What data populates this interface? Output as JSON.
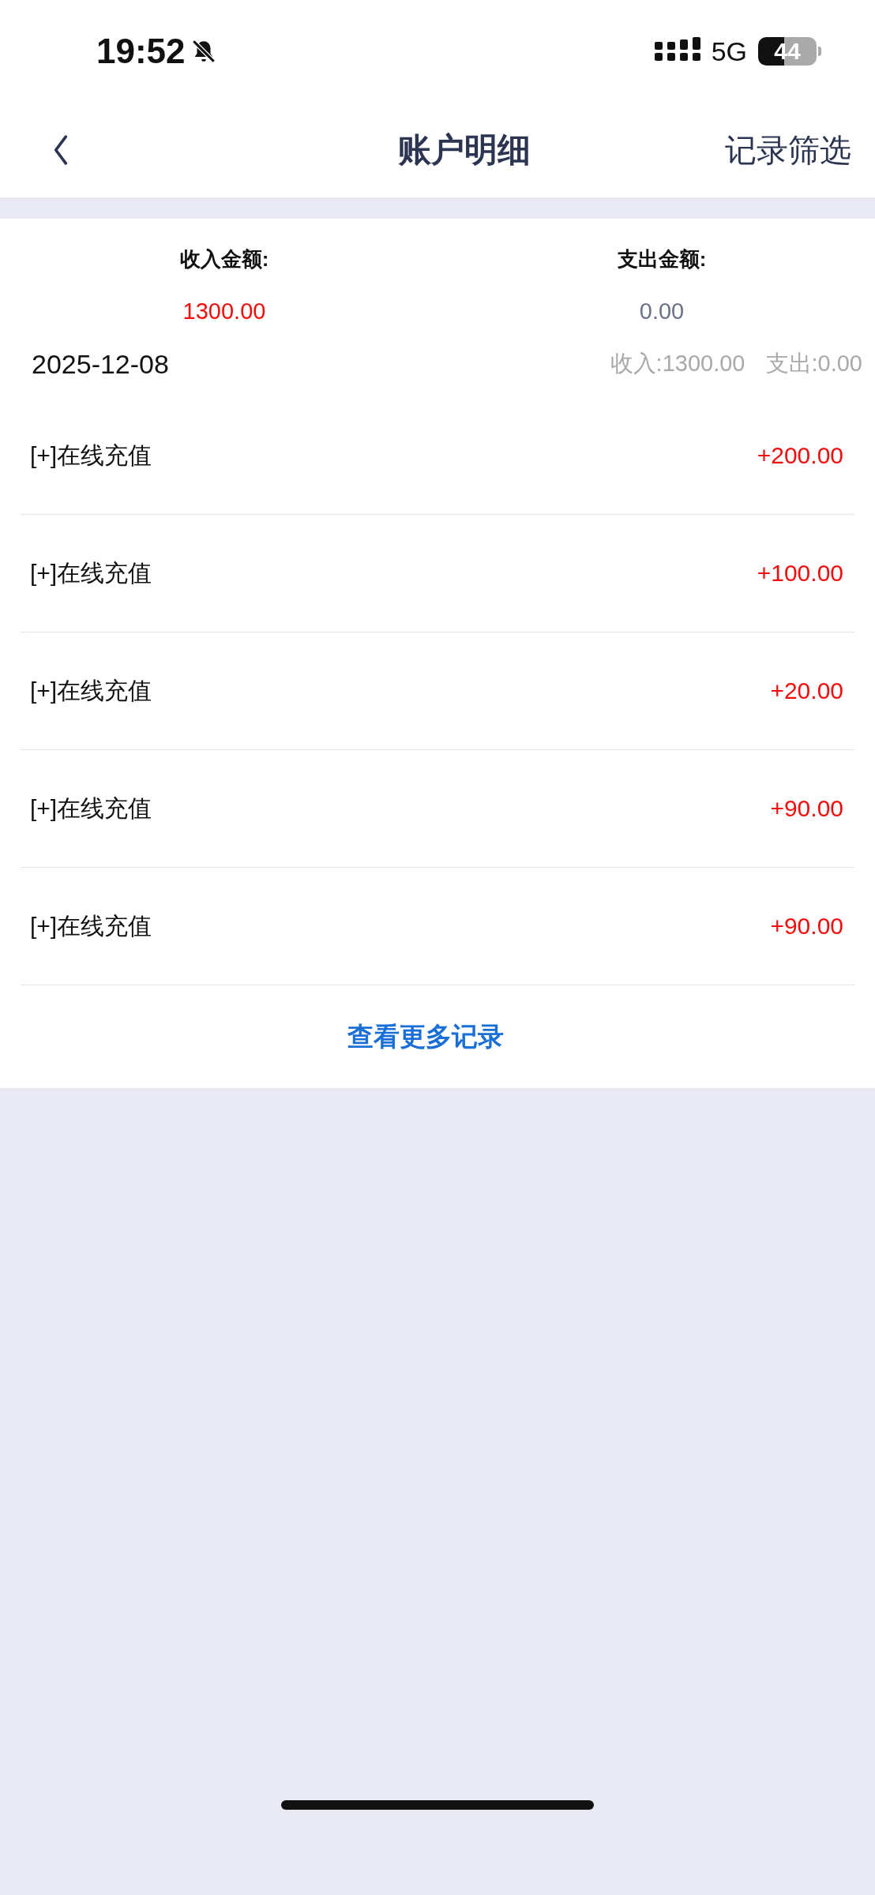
{
  "status_bar": {
    "time": "19:52",
    "network": "5G",
    "battery": "44"
  },
  "nav": {
    "title": "账户明细",
    "action": "记录筛选"
  },
  "summary": [
    {
      "label": "收入金额:",
      "value": "1300.00",
      "kind": "income"
    },
    {
      "label": "支出金额:",
      "value": "0.00",
      "kind": "expense"
    }
  ],
  "day": {
    "date": "2025-12-08",
    "income": "收入:1300.00",
    "expense": "支出:0.00"
  },
  "records": [
    {
      "title": "[+]在线充值",
      "amount": "+200.00",
      "kind": "income"
    },
    {
      "title": "[+]在线充值",
      "amount": "+100.00",
      "kind": "income"
    },
    {
      "title": "[+]在线充值",
      "amount": "+20.00",
      "kind": "income"
    },
    {
      "title": "[+]在线充值",
      "amount": "+90.00",
      "kind": "income"
    },
    {
      "title": "[+]在线充值",
      "amount": "+90.00",
      "kind": "income"
    }
  ],
  "more_link": "查看更多记录"
}
